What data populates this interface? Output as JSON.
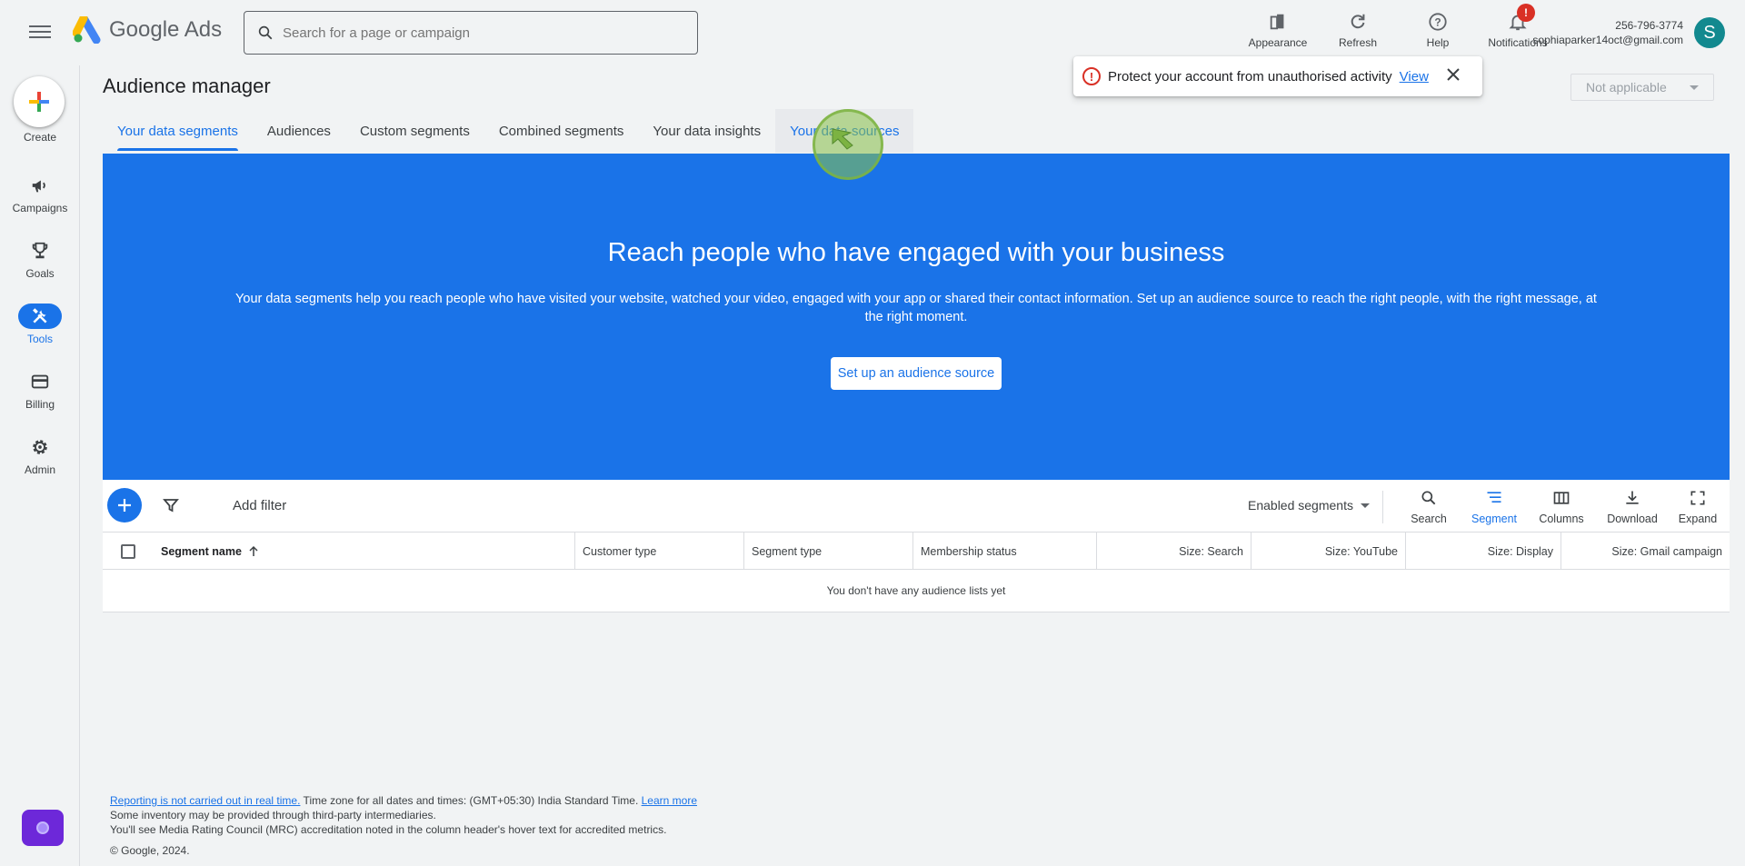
{
  "app": {
    "logo_text": "Google Ads",
    "search_placeholder": "Search for a page or campaign"
  },
  "top_actions": [
    {
      "label": "Appearance",
      "icon": "appearance-icon"
    },
    {
      "label": "Refresh",
      "icon": "refresh-icon"
    },
    {
      "label": "Help",
      "icon": "help-icon"
    },
    {
      "label": "Notifications",
      "icon": "notifications-icon",
      "badge": "!"
    }
  ],
  "account": {
    "id": "256-796-3774",
    "email": "sophiaparker14oct@gmail.com",
    "avatar_letter": "S"
  },
  "leftnav": {
    "create_label": "Create",
    "items": [
      {
        "label": "Campaigns",
        "icon": "megaphone-icon",
        "active": false
      },
      {
        "label": "Goals",
        "icon": "trophy-icon",
        "active": false
      },
      {
        "label": "Tools",
        "icon": "tools-icon",
        "active": true
      },
      {
        "label": "Billing",
        "icon": "credit-card-icon",
        "active": false
      },
      {
        "label": "Admin",
        "icon": "gear-icon",
        "active": false
      }
    ]
  },
  "page": {
    "title": "Audience manager",
    "tabs": [
      {
        "label": "Your data segments",
        "active": true
      },
      {
        "label": "Audiences"
      },
      {
        "label": "Custom segments"
      },
      {
        "label": "Combined segments"
      },
      {
        "label": "Your data insights"
      },
      {
        "label": "Your data sources",
        "hover": true
      }
    ],
    "scope_select": "Not applicable"
  },
  "toast": {
    "message": "Protect your account from unauthorised activity",
    "link": "View"
  },
  "hero": {
    "heading": "Reach people who have engaged with your business",
    "body": "Your data segments help you reach people who have visited your website, watched your video, engaged with your app or shared their contact information. Set up an audience source to reach the right people, with the right message, at the right moment.",
    "button": "Set up an audience source"
  },
  "toolbar": {
    "add_filter": "Add filter",
    "segment_filter": "Enabled segments",
    "buttons": [
      {
        "label": "Search",
        "icon": "search-icon"
      },
      {
        "label": "Segment",
        "icon": "segment-icon",
        "active": true
      },
      {
        "label": "Columns",
        "icon": "columns-icon"
      },
      {
        "label": "Download",
        "icon": "download-icon"
      },
      {
        "label": "Expand",
        "icon": "expand-icon"
      }
    ]
  },
  "table": {
    "columns": [
      "Segment name",
      "Customer type",
      "Segment type",
      "Membership status",
      "Size: Search",
      "Size: YouTube",
      "Size: Display",
      "Size: Gmail campaign"
    ],
    "empty_message": "You don't have any audience lists yet"
  },
  "footer": {
    "link1": "Reporting is not carried out in real time.",
    "timezone": " Time zone for all dates and times: (GMT+05:30) India Standard Time. ",
    "link2": "Learn more",
    "line2": "Some inventory may be provided through third-party intermediaries.",
    "line3": "You'll see Media Rating Council (MRC) accreditation noted in the column header's hover text for accredited metrics.",
    "copyright": "© Google, 2024."
  },
  "colors": {
    "accent": "#1a73e8",
    "background": "#f1f3f4",
    "alert": "#d93025"
  }
}
